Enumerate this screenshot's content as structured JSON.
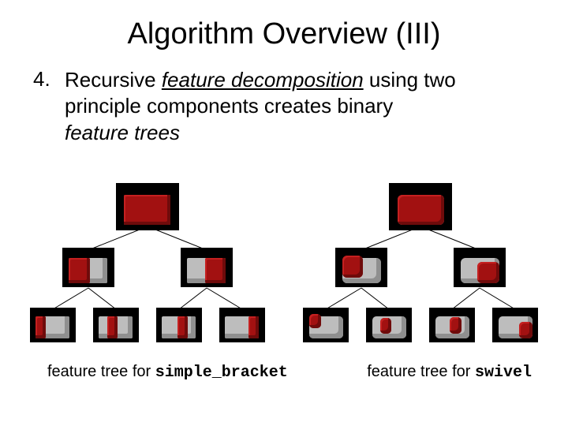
{
  "title": "Algorithm Overview (III)",
  "bullet": {
    "number": "4.",
    "line1_plain": "Recursive ",
    "line1_italic_ul": "feature decomposition",
    "line1_rest": " using two",
    "line2": "principle components creates binary",
    "line3_italic": "feature trees"
  },
  "captions": {
    "left_prefix": "feature tree for ",
    "left_mono": "simple_bracket",
    "right_prefix": "feature tree for ",
    "right_mono": "swivel"
  },
  "trees": {
    "left_label": "simple_bracket",
    "right_label": "swivel"
  }
}
